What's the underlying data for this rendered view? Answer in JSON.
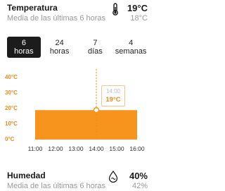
{
  "temperature": {
    "title": "Temperatura",
    "subtitle": "Media de las últimas 6 horas",
    "value": "19°C",
    "average": "18°C",
    "icon": "thermometer-icon"
  },
  "tabs": [
    {
      "line1": "6",
      "line2": "horas",
      "active": true
    },
    {
      "line1": "24",
      "line2": "horas",
      "active": false
    },
    {
      "line1": "7",
      "line2": "días",
      "active": false
    },
    {
      "line1": "4",
      "line2": "semanas",
      "active": false
    }
  ],
  "chart_data": {
    "type": "area",
    "x": [
      "11:00",
      "12:00",
      "13:00",
      "14:00",
      "15:00",
      "16:00"
    ],
    "y_tick_labels": [
      "40°C",
      "30°C",
      "20°C",
      "10°C",
      "0°C"
    ],
    "ylim": [
      0,
      40
    ],
    "series": [
      {
        "values": [
          19,
          19,
          19,
          19,
          19,
          19
        ]
      }
    ],
    "highlight": {
      "time": "14:00",
      "value": "19°C"
    },
    "colors": {
      "fill": "#f7941d",
      "axis_labels": "#f08a1c",
      "marker_line": "#f08a1c"
    }
  },
  "humidity": {
    "title": "Humedad",
    "subtitle": "Media de las últimas 6 horas",
    "value": "40%",
    "average": "42%",
    "icon": "water-drop-icon"
  }
}
